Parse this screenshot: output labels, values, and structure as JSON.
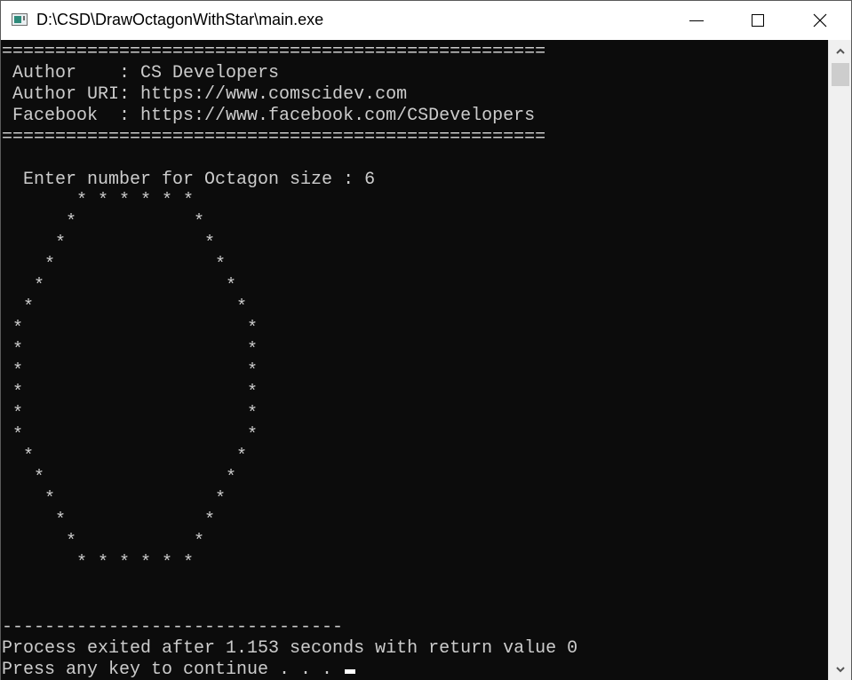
{
  "window": {
    "title": "D:\\CSD\\DrawOctagonWithStar\\main.exe",
    "icon": "console-app-icon",
    "controls": {
      "minimize": "minimize-icon",
      "maximize": "maximize-icon",
      "close": "close-icon"
    }
  },
  "console": {
    "lines": [
      "===================================================",
      " Author    : CS Developers",
      " Author URI: https://www.comscidev.com",
      " Facebook  : https://www.facebook.com/CSDevelopers",
      "===================================================",
      "",
      "  Enter number for Octagon size : 6",
      "       * * * * * *",
      "      *           *",
      "     *             *",
      "    *               *",
      "   *                 *",
      "  *                   *",
      " *                     *",
      " *                     *",
      " *                     *",
      " *                     *",
      " *                     *",
      " *                     *",
      "  *                   *",
      "   *                 *",
      "    *               *",
      "     *             *",
      "      *           *",
      "       * * * * * *",
      "",
      "",
      "--------------------------------",
      "Process exited after 1.153 seconds with return value 0",
      "Press any key to continue . . . "
    ]
  },
  "scrollbar": {
    "up": "▲",
    "down": "▼"
  },
  "colors": {
    "console_bg": "#0c0c0c",
    "console_fg": "#cccccc"
  }
}
